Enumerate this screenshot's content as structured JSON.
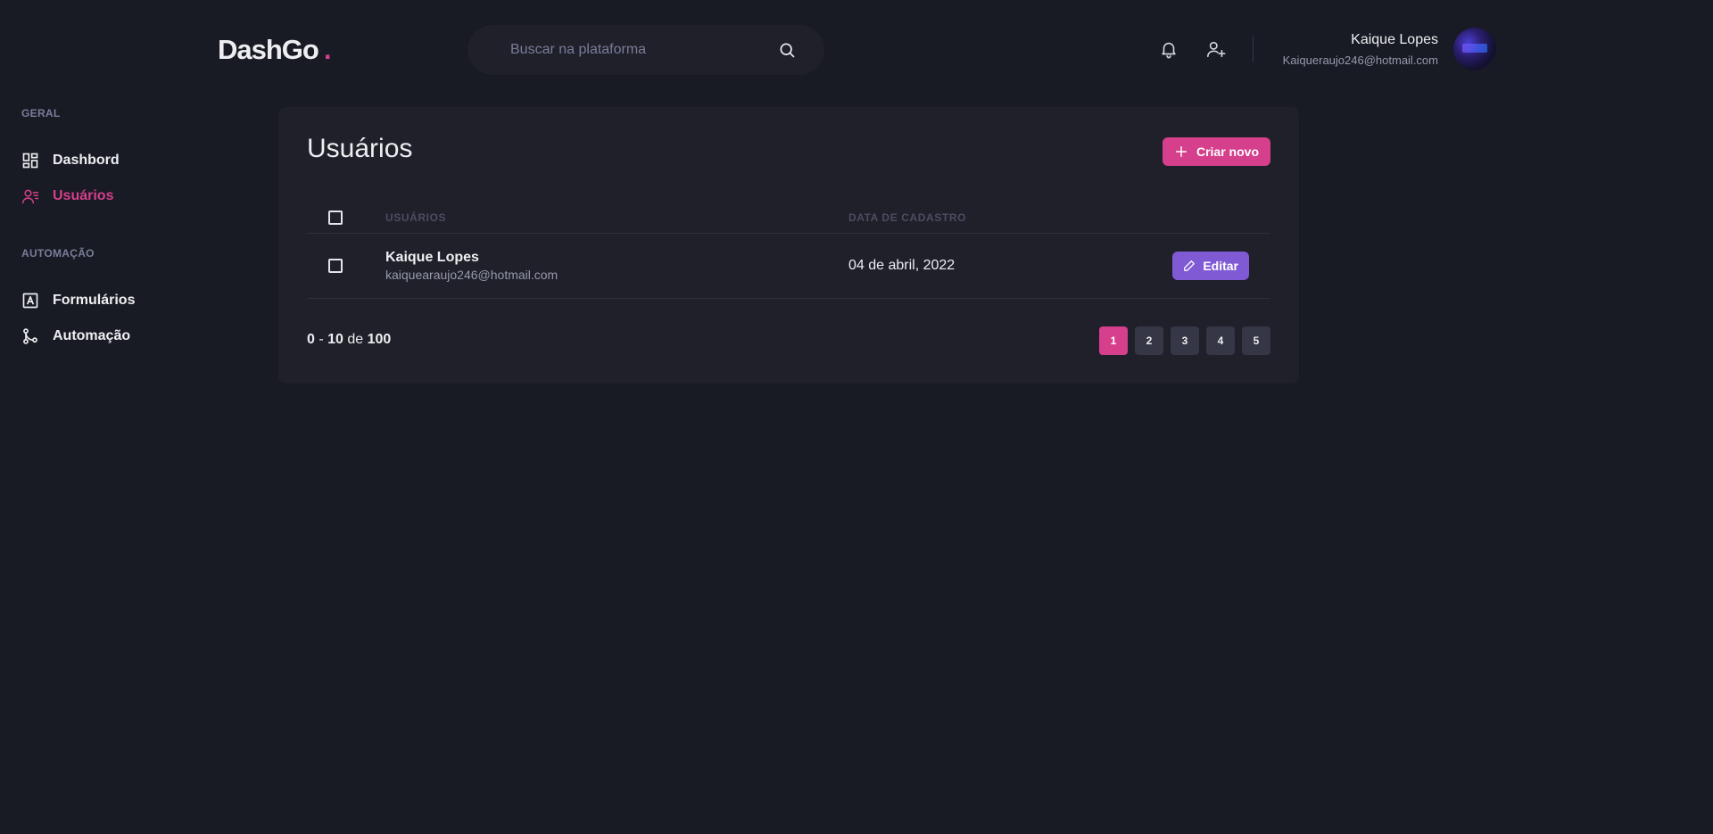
{
  "header": {
    "logo": "DashGo",
    "logo_dot": ".",
    "search_placeholder": "Buscar na plataforma",
    "icons": [
      "search-icon",
      "bell-icon",
      "user-add-icon"
    ],
    "profile": {
      "name": "Kaique Lopes",
      "email": "Kaiqueraujo246@hotmail.com"
    }
  },
  "sidebar": {
    "sections": [
      {
        "title": "GERAL",
        "items": [
          {
            "label": "Dashbord",
            "icon": "dashboard-icon",
            "active": false
          },
          {
            "label": "Usuários",
            "icon": "users-icon",
            "active": true
          }
        ]
      },
      {
        "title": "AUTOMAÇÃO",
        "items": [
          {
            "label": "Formulários",
            "icon": "form-icon",
            "active": false
          },
          {
            "label": "Automação",
            "icon": "git-merge-icon",
            "active": false
          }
        ]
      }
    ]
  },
  "main": {
    "title": "Usuários",
    "create_button": "Criar novo",
    "table": {
      "columns": [
        "USUÁRIOS",
        "DATA DE CADASTRO"
      ],
      "rows": [
        {
          "name": "Kaique Lopes",
          "email": "kaiquearaujo246@hotmail.com",
          "date": "04 de abril, 2022",
          "action": "Editar"
        }
      ]
    },
    "pagination": {
      "start": "0",
      "sep": " - ",
      "end": "10",
      "of": " de ",
      "total": "100",
      "pages": [
        "1",
        "2",
        "3",
        "4",
        "5"
      ],
      "current": "1"
    }
  },
  "colors": {
    "background": "#181B23",
    "card": "#1F2029",
    "accent": "#D53F8C",
    "edit": "#805AD5"
  }
}
